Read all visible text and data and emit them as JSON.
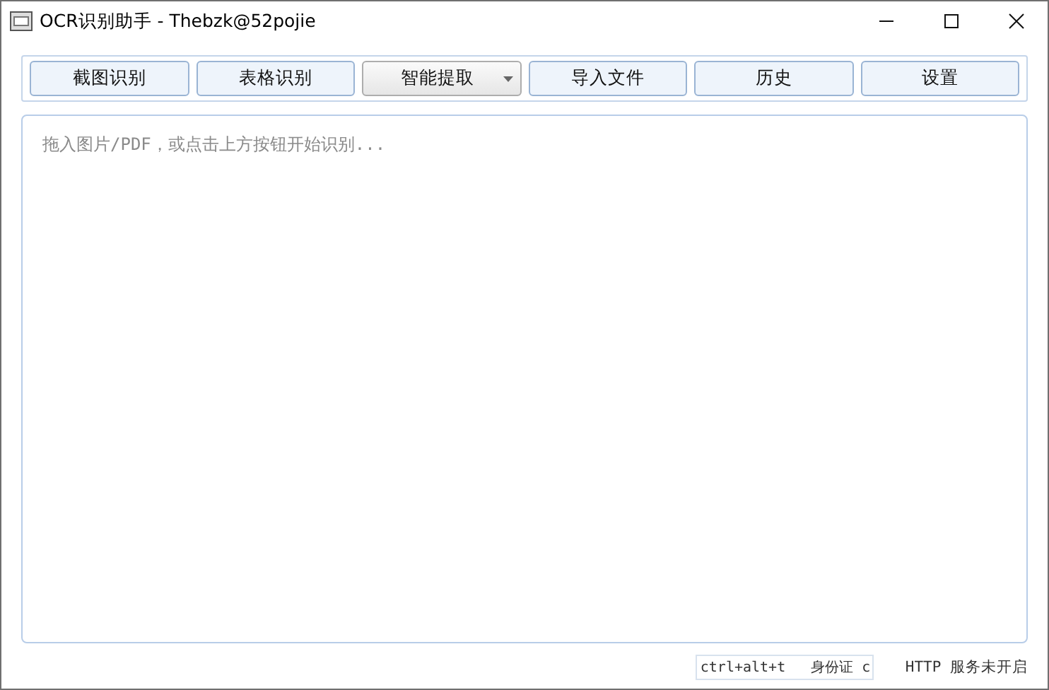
{
  "window": {
    "title": "OCR识别助手 - Thebzk@52pojie"
  },
  "toolbar": [
    {
      "label": "截图识别",
      "kind": "button"
    },
    {
      "label": "表格识别",
      "kind": "button"
    },
    {
      "label": "智能提取",
      "kind": "dropdown"
    },
    {
      "label": "导入文件",
      "kind": "button"
    },
    {
      "label": "历史",
      "kind": "button"
    },
    {
      "label": "设置",
      "kind": "button"
    }
  ],
  "editor": {
    "placeholder": "拖入图片/PDF，或点击上方按钮开始识别..."
  },
  "status_bar": {
    "hotkey_field": "ctrl+alt+t   身份证 c",
    "service_status": "HTTP 服务未开启"
  }
}
